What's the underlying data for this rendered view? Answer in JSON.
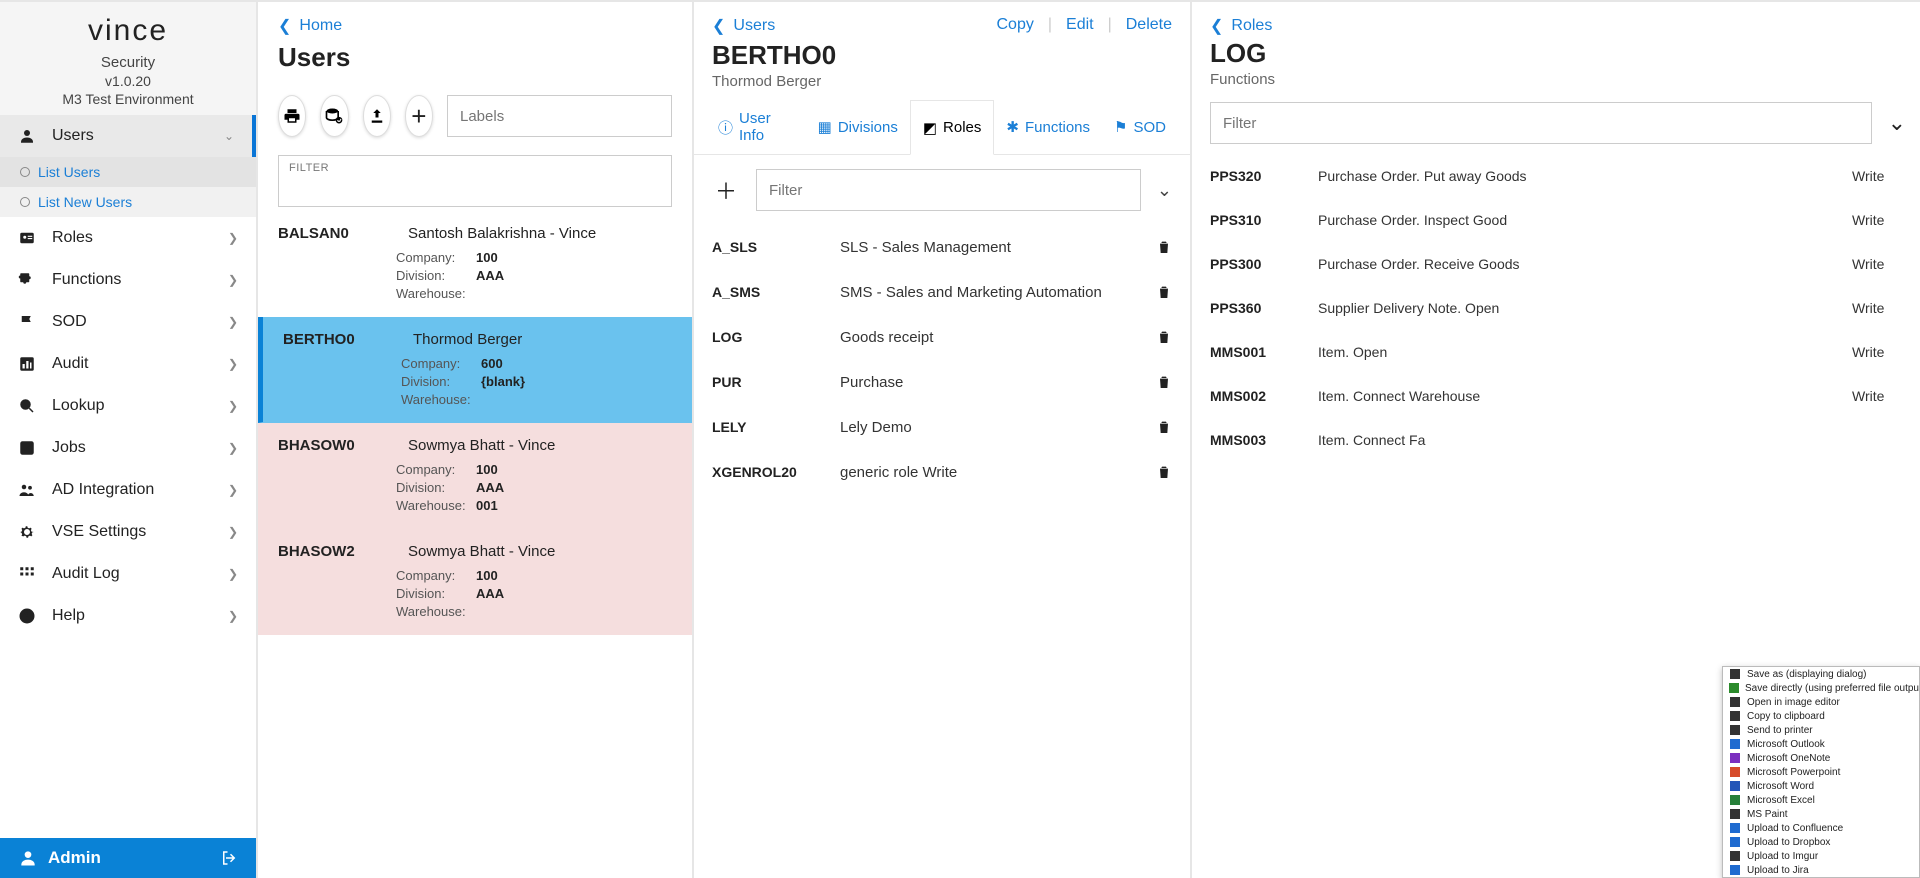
{
  "brand": {
    "logo": "vince",
    "product": "Security",
    "version": "v1.0.20",
    "env": "M3 Test Environment"
  },
  "nav": {
    "items": [
      {
        "label": "Users",
        "icon": "user-icon",
        "expanded": true,
        "subs": [
          {
            "label": "List Users"
          },
          {
            "label": "List New Users"
          }
        ]
      },
      {
        "label": "Roles",
        "icon": "id-icon"
      },
      {
        "label": "Functions",
        "icon": "puzzle-icon"
      },
      {
        "label": "SOD",
        "icon": "flag-icon"
      },
      {
        "label": "Audit",
        "icon": "chart-icon"
      },
      {
        "label": "Lookup",
        "icon": "search-icon"
      },
      {
        "label": "Jobs",
        "icon": "check-icon"
      },
      {
        "label": "AD Integration",
        "icon": "people-icon"
      },
      {
        "label": "VSE Settings",
        "icon": "gear-icon"
      },
      {
        "label": "Audit Log",
        "icon": "grid-icon"
      },
      {
        "label": "Help",
        "icon": "help-icon"
      }
    ]
  },
  "adminbar": {
    "label": "Admin"
  },
  "users_pane": {
    "crumb": "Home",
    "title": "Users",
    "labels_placeholder": "Labels",
    "filter_label": "FILTER",
    "list": [
      {
        "id": "BALSAN0",
        "name": "Santosh Balakrishna - Vince",
        "company": "100",
        "division": "AAA",
        "warehouse": "",
        "state": ""
      },
      {
        "id": "BERTHO0",
        "name": "Thormod Berger",
        "company": "600",
        "division": "{blank}",
        "warehouse": "",
        "state": "selected"
      },
      {
        "id": "BHASOW0",
        "name": "Sowmya Bhatt - Vince",
        "company": "100",
        "division": "AAA",
        "warehouse": "001",
        "state": "odd"
      },
      {
        "id": "BHASOW2",
        "name": "Sowmya Bhatt - Vince",
        "company": "100",
        "division": "AAA",
        "warehouse": "",
        "state": "odd"
      }
    ],
    "meta_labels": {
      "company": "Company:",
      "division": "Division:",
      "warehouse": "Warehouse:"
    }
  },
  "detail_pane": {
    "crumb": "Users",
    "actions": {
      "copy": "Copy",
      "edit": "Edit",
      "delete": "Delete"
    },
    "title": "BERTHO0",
    "subtitle": "Thormod Berger",
    "tabs": {
      "userinfo": "User Info",
      "divisions": "Divisions",
      "roles": "Roles",
      "functions": "Functions",
      "sod": "SOD"
    },
    "filter_placeholder": "Filter",
    "roles": [
      {
        "code": "A_SLS",
        "name": "SLS - Sales Management"
      },
      {
        "code": "A_SMS",
        "name": "SMS - Sales and Marketing Automation"
      },
      {
        "code": "LOG",
        "name": "Goods receipt"
      },
      {
        "code": "PUR",
        "name": "Purchase"
      },
      {
        "code": "LELY",
        "name": "Lely Demo"
      },
      {
        "code": "XGENROL20",
        "name": "generic role Write"
      }
    ]
  },
  "right_pane": {
    "crumb": "Roles",
    "title": "LOG",
    "subtitle": "Functions",
    "filter_placeholder": "Filter",
    "functions": [
      {
        "code": "PPS320",
        "name": "Purchase Order. Put away Goods",
        "perm": "Write"
      },
      {
        "code": "PPS310",
        "name": "Purchase Order. Inspect Good",
        "perm": "Write"
      },
      {
        "code": "PPS300",
        "name": "Purchase Order. Receive Goods",
        "perm": "Write"
      },
      {
        "code": "PPS360",
        "name": "Supplier Delivery Note. Open",
        "perm": "Write"
      },
      {
        "code": "MMS001",
        "name": "Item. Open",
        "perm": "Write"
      },
      {
        "code": "MMS002",
        "name": "Item. Connect Warehouse",
        "perm": "Write"
      },
      {
        "code": "MMS003",
        "name": "Item. Connect Fa",
        "perm": ""
      }
    ]
  },
  "context_menu": {
    "items": [
      {
        "label": "Save as (displaying dialog)",
        "color": "#333"
      },
      {
        "label": "Save directly (using preferred file output setti",
        "color": "#2b8a2b"
      },
      {
        "label": "Open in image editor",
        "color": "#333"
      },
      {
        "label": "Copy to clipboard",
        "color": "#333"
      },
      {
        "label": "Send to printer",
        "color": "#333"
      },
      {
        "label": "Microsoft Outlook",
        "color": "#1f6bd0"
      },
      {
        "label": "Microsoft OneNote",
        "color": "#7b2fbf"
      },
      {
        "label": "Microsoft Powerpoint",
        "color": "#d64b2a"
      },
      {
        "label": "Microsoft Word",
        "color": "#2355b8"
      },
      {
        "label": "Microsoft Excel",
        "color": "#26803a"
      },
      {
        "label": "MS Paint",
        "color": "#333"
      },
      {
        "label": "Upload to Confluence",
        "color": "#1f6bd0"
      },
      {
        "label": "Upload to Dropbox",
        "color": "#1f6bd0"
      },
      {
        "label": "Upload to Imgur",
        "color": "#333"
      },
      {
        "label": "Upload to Jira",
        "color": "#1f6bd0"
      }
    ]
  }
}
